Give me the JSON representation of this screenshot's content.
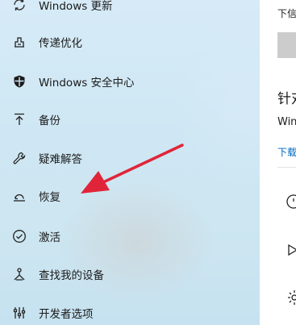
{
  "nav": {
    "items": [
      {
        "label": "Windows 更新",
        "icon": "sync-icon"
      },
      {
        "label": "传递优化",
        "icon": "delivery-optimization-icon"
      },
      {
        "label": "Windows 安全中心",
        "icon": "shield-icon"
      },
      {
        "label": "备份",
        "icon": "backup-icon"
      },
      {
        "label": "疑难解答",
        "icon": "wrench-icon"
      },
      {
        "label": "恢复",
        "icon": "recovery-icon"
      },
      {
        "label": "激活",
        "icon": "check-circle-icon"
      },
      {
        "label": "查找我的设备",
        "icon": "find-device-icon"
      },
      {
        "label": "开发者选项",
        "icon": "developer-icon"
      }
    ]
  },
  "content": {
    "top_text": "下信",
    "heading": "针对",
    "body_text": "Win",
    "download_link": "下载"
  },
  "colors": {
    "accent_link": "#0067c0",
    "arrow": "#e0253a"
  }
}
